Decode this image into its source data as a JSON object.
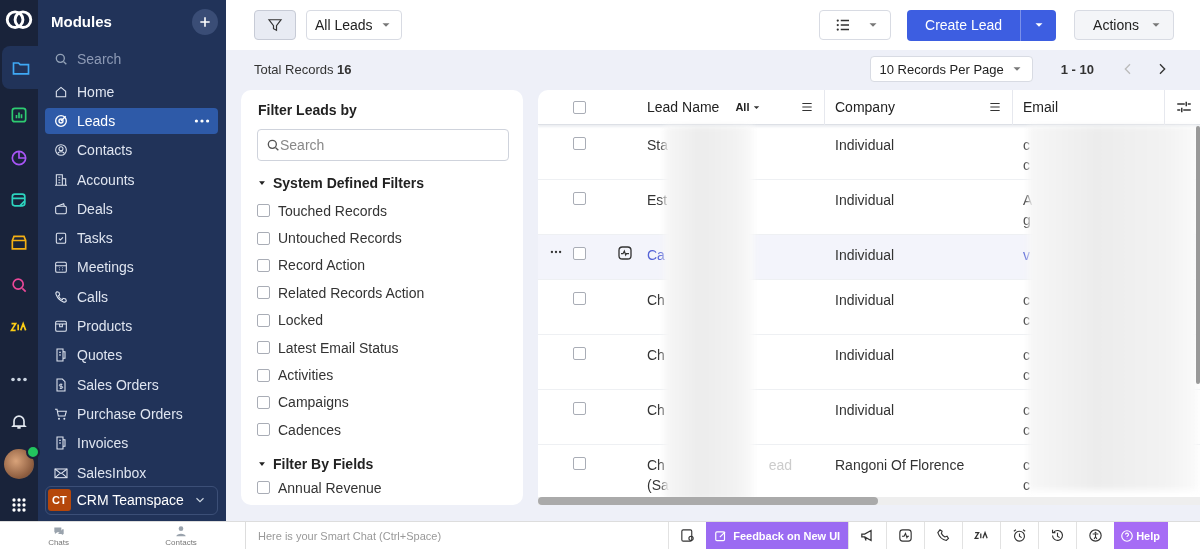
{
  "sidebar": {
    "title": "Modules",
    "search": {
      "placeholder": "Search"
    },
    "rail": [
      {
        "selected": true
      },
      {
        "selected": false
      },
      {
        "selected": false
      },
      {
        "selected": false
      },
      {
        "selected": false
      },
      {
        "selected": false
      },
      {
        "selected": false
      },
      {
        "selected": false
      },
      {
        "selected": false
      },
      {
        "selected": false
      }
    ],
    "items": [
      {
        "label": "Home",
        "selected": false
      },
      {
        "label": "Leads",
        "selected": true
      },
      {
        "label": "Contacts",
        "selected": false
      },
      {
        "label": "Accounts",
        "selected": false
      },
      {
        "label": "Deals",
        "selected": false
      },
      {
        "label": "Tasks",
        "selected": false
      },
      {
        "label": "Meetings",
        "selected": false
      },
      {
        "label": "Calls",
        "selected": false
      },
      {
        "label": "Products",
        "selected": false
      },
      {
        "label": "Quotes",
        "selected": false
      },
      {
        "label": "Sales Orders",
        "selected": false
      },
      {
        "label": "Purchase Orders",
        "selected": false
      },
      {
        "label": "Invoices",
        "selected": false
      },
      {
        "label": "SalesInbox",
        "selected": false
      }
    ],
    "teamspace": {
      "badge": "CT",
      "label": "CRM Teamspace"
    }
  },
  "toolbar": {
    "view": "All Leads",
    "create": "Create Lead",
    "actions": "Actions"
  },
  "summary": {
    "label": "Total Records",
    "count": "16",
    "per_page": "10 Records Per Page",
    "range": "1 - 10"
  },
  "filters": {
    "title": "Filter Leads by",
    "search": {
      "placeholder": "Search"
    },
    "groups": [
      {
        "title": "System Defined Filters",
        "expanded": true,
        "items": [
          {
            "label": "Touched Records",
            "checked": false
          },
          {
            "label": "Untouched Records",
            "checked": false
          },
          {
            "label": "Record Action",
            "checked": false
          },
          {
            "label": "Related Records Action",
            "checked": false
          },
          {
            "label": "Locked",
            "checked": false
          },
          {
            "label": "Latest Email Status",
            "checked": false
          },
          {
            "label": "Activities",
            "checked": false
          },
          {
            "label": "Campaigns",
            "checked": false
          },
          {
            "label": "Cadences",
            "checked": false
          }
        ]
      },
      {
        "title": "Filter By Fields",
        "expanded": true,
        "items": [
          {
            "label": "Annual Revenue",
            "checked": false
          }
        ]
      }
    ]
  },
  "table": {
    "select_all_checked": false,
    "columns": [
      {
        "label": "Lead Name",
        "filter": "All"
      },
      {
        "label": "Company"
      },
      {
        "label": "Email"
      }
    ],
    "rows": [
      {
        "name": [
          "Sta"
        ],
        "company": "Individual",
        "email": [
          "c",
          "c"
        ],
        "link": false,
        "hovered": false,
        "checked": false
      },
      {
        "name": [
          "Est"
        ],
        "company": "Individual",
        "email": [
          "A",
          "g"
        ],
        "link": false,
        "hovered": false,
        "checked": false
      },
      {
        "name": [
          "Ca"
        ],
        "company": "Individual",
        "email": [
          "v"
        ],
        "link": true,
        "hovered": true,
        "checked": false
      },
      {
        "name": [
          "Ch"
        ],
        "company": "Individual",
        "email": [
          "c",
          "c"
        ],
        "link": false,
        "hovered": false,
        "checked": false
      },
      {
        "name": [
          "Ch"
        ],
        "company": "Individual",
        "email": [
          "c",
          "c"
        ],
        "link": false,
        "hovered": false,
        "checked": false
      },
      {
        "name": [
          "Ch"
        ],
        "company": "Individual",
        "email": [
          "c",
          "c"
        ],
        "link": false,
        "hovered": false,
        "checked": false
      },
      {
        "name": [
          "Ch",
          "(Sa"
        ],
        "name_tail": "ead",
        "company": "Rangoni Of Florence",
        "email": [
          "c",
          "c"
        ],
        "link": false,
        "hovered": false,
        "checked": false
      }
    ]
  },
  "bottom_bar": {
    "left": [
      {
        "label": "Chats"
      },
      {
        "label": "Contacts"
      }
    ],
    "chat_placeholder": "Here is your Smart Chat (Ctrl+Space)",
    "feedback": "Feedback on New UI",
    "help": "Help"
  }
}
